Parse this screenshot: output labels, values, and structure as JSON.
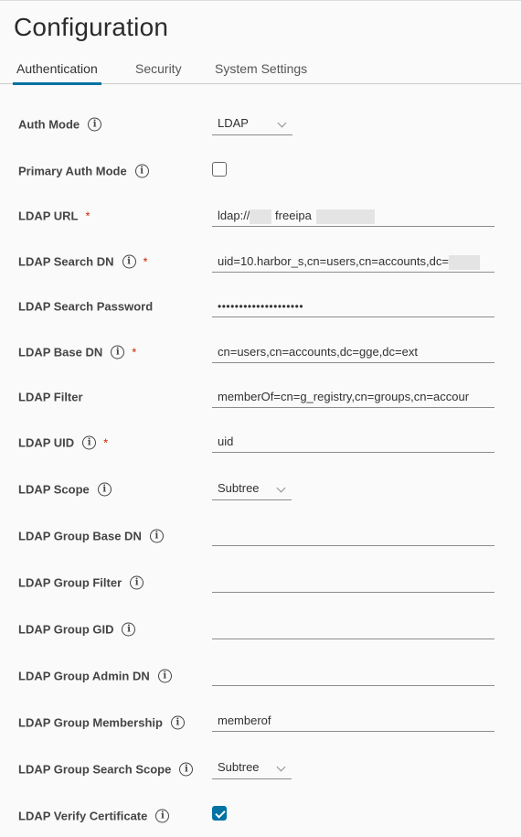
{
  "page": {
    "title": "Configuration"
  },
  "tabs": [
    {
      "label": "Authentication",
      "active": true
    },
    {
      "label": "Security",
      "active": false
    },
    {
      "label": "System Settings",
      "active": false
    }
  ],
  "fields": {
    "auth_mode": {
      "label": "Auth Mode",
      "value": "LDAP"
    },
    "primary_auth_mode": {
      "label": "Primary Auth Mode",
      "checked": false
    },
    "ldap_url": {
      "label": "LDAP URL",
      "value_prefix": "ldap://",
      "value_middle": "freeipa"
    },
    "ldap_search_dn": {
      "label": "LDAP Search DN",
      "value": "uid=10.harbor_s,cn=users,cn=accounts,dc="
    },
    "ldap_search_password": {
      "label": "LDAP Search Password",
      "value": "••••••••••••••••••••"
    },
    "ldap_base_dn": {
      "label": "LDAP Base DN",
      "value": "cn=users,cn=accounts,dc=gge,dc=ext"
    },
    "ldap_filter": {
      "label": "LDAP Filter",
      "value": "memberOf=cn=g_registry,cn=groups,cn=accour"
    },
    "ldap_uid": {
      "label": "LDAP UID",
      "value": "uid"
    },
    "ldap_scope": {
      "label": "LDAP Scope",
      "value": "Subtree"
    },
    "ldap_group_base_dn": {
      "label": "LDAP Group Base DN",
      "value": ""
    },
    "ldap_group_filter": {
      "label": "LDAP Group Filter",
      "value": ""
    },
    "ldap_group_gid": {
      "label": "LDAP Group GID",
      "value": ""
    },
    "ldap_group_admin_dn": {
      "label": "LDAP Group Admin DN",
      "value": ""
    },
    "ldap_group_membership": {
      "label": "LDAP Group Membership",
      "value": "memberof"
    },
    "ldap_group_search_scope": {
      "label": "LDAP Group Search Scope",
      "value": "Subtree"
    },
    "ldap_verify_certificate": {
      "label": "LDAP Verify Certificate",
      "checked": true
    }
  },
  "required_mark": "*",
  "info_glyph": "i",
  "icons": {
    "info": "info-icon",
    "dropdown": "chevron-down-icon",
    "check": "check-icon"
  },
  "colors": {
    "accent": "#0072a3",
    "required": "#c92100",
    "text": "#313131"
  }
}
